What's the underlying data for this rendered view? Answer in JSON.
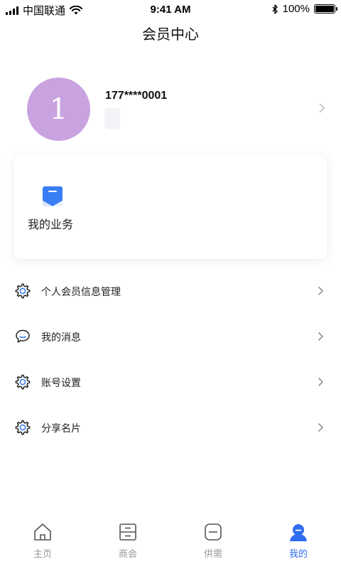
{
  "status_bar": {
    "carrier": "中国联通",
    "time": "9:41 AM",
    "battery": "100%",
    "battery_level": 1.0
  },
  "header": {
    "title": "会员中心"
  },
  "profile": {
    "avatar_text": "1",
    "avatar_color": "#c9a2e0",
    "phone": "177****0001"
  },
  "business": {
    "label": "我的业务",
    "icon": "document-icon"
  },
  "menu": [
    {
      "label": "个人会员信息管理",
      "icon": "gear-icon"
    },
    {
      "label": "我的消息",
      "icon": "chat-bubble-icon"
    },
    {
      "label": "账号设置",
      "icon": "gear-icon"
    },
    {
      "label": "分享名片",
      "icon": "gear-icon"
    }
  ],
  "tabbar": {
    "items": [
      {
        "label": "主页",
        "icon": "home-icon",
        "active": false
      },
      {
        "label": "商会",
        "icon": "cabinet-icon",
        "active": false
      },
      {
        "label": "供需",
        "icon": "square-box-icon",
        "active": false
      },
      {
        "label": "我的",
        "icon": "user-icon",
        "active": true
      }
    ]
  },
  "colors": {
    "accent": "#2f6cf0",
    "inactive_tab": "#999999",
    "icon_blue": "#3a7ef5"
  }
}
